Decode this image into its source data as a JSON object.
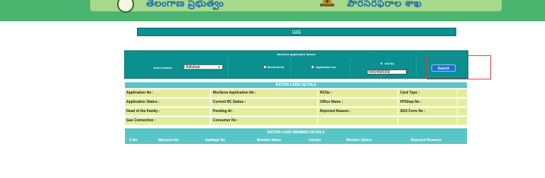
{
  "header": {
    "title_left": "తెలంగాణ ప్రభుత్వం",
    "title_right": "పౌరసరఫరాల శాఖ",
    "colors": {
      "banner": "#4bb56f",
      "banner_inner": "#a6d98c"
    }
  },
  "nav": {
    "home_label": "HOME"
  },
  "search": {
    "panel_title": "MeeSeva Application Search",
    "district_label": "Select District",
    "district_value": "Adilabad",
    "radio_meeseva": "MeeSeva No",
    "radio_application": "Application No.",
    "radio_uid": "Uid No.",
    "uid_value": "54654585958",
    "search_button": "Search"
  },
  "ration_card": {
    "title": "RATION CARD DETAILS",
    "rows": [
      [
        "Application No :",
        "MeeSeva Application No :",
        "RCNo :",
        "Card Type :"
      ],
      [
        "Application Status :",
        "Current RC Status :",
        "Office Name :",
        "FPShop No :"
      ],
      [
        "Head of the Family :",
        "Pending At :",
        "Rejected Reason :",
        "SKS Form No :"
      ],
      [
        "Gas Connection :",
        "Consumer No :",
        "",
        ""
      ]
    ]
  },
  "members": {
    "title": "RATION CARD MEMBER DETAILS",
    "columns": [
      "S No",
      "Meeseva No",
      "Aadhaar No",
      "Member Name",
      "Gender",
      "Member Status",
      "Rejected Reasons"
    ]
  },
  "colors": {
    "teal": "#0b8f8f",
    "header_teal": "#59c6c6",
    "row_yellow": "#e2ee9d",
    "button_blue": "#1e6bd6",
    "highlight_red": "#e43c3c"
  }
}
